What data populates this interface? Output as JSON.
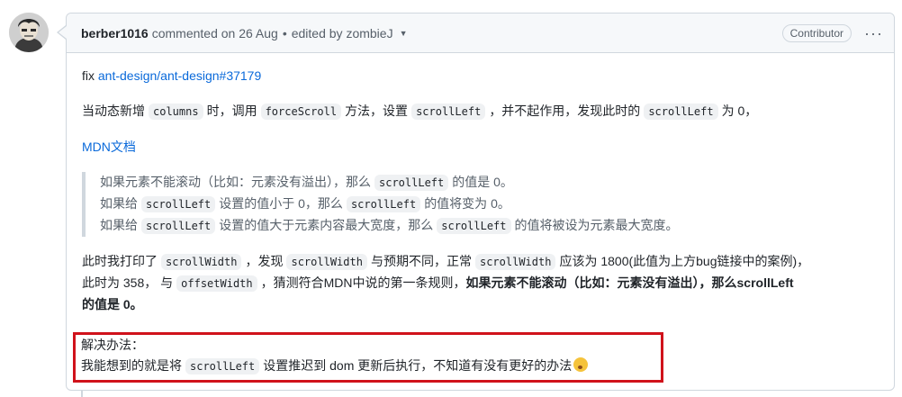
{
  "header": {
    "author": "berber1016",
    "action": "commented on 26 Aug",
    "separator": "•",
    "edited": "edited by zombieJ",
    "badge": "Contributor",
    "more": "···"
  },
  "body": {
    "fix_prefix": "fix",
    "fix_link": "ant-design/ant-design#37179",
    "p2": {
      "t1": "当动态新增",
      "c1": "columns",
      "t2": "时，调用",
      "c2": "forceScroll",
      "t3": "方法，设置",
      "c3": "scrollLeft",
      "t4": "，并不起作用，发现此时的",
      "c4": "scrollLeft",
      "t5": "为 0，"
    },
    "mdn_link": "MDN文档",
    "quote": {
      "l1a": "如果元素不能滚动（比如：元素没有溢出），那么",
      "l1c": "scrollLeft",
      "l1b": "的值是 0。",
      "l2a": "如果给",
      "l2c1": "scrollLeft",
      "l2b": "设置的值小于 0，那么",
      "l2c2": "scrollLeft",
      "l2d": "的值将变为 0。",
      "l3a": "如果给",
      "l3c1": "scrollLeft",
      "l3b": "设置的值大于元素内容最大宽度，那么",
      "l3c2": "scrollLeft",
      "l3d": "的值将被设为元素最大宽度。"
    },
    "p4": {
      "t1": "此时我打印了",
      "c1": "scrollWidth",
      "t2": "，发现",
      "c2": "scrollWidth",
      "t3": "与预期不同，正常",
      "c3": "scrollWidth",
      "t4": "应该为 1800(此值为上方bug链接中的案例)，",
      "t5": "此时为 358， 与",
      "c4": "offsetWidth",
      "t6": "，猜测符合MDN中说的第一条规则，",
      "b1": "如果元素不能滚动（比如：元素没有溢出），那么scrollLeft",
      "b2": "的值是 0。"
    },
    "solution": {
      "title": "解决办法：",
      "t1": "我能想到的就是将",
      "c1": "scrollLeft",
      "t2": "设置推迟到 dom 更新后执行，不知道有没有更好的办法"
    }
  },
  "colors": {
    "link": "#0969da",
    "highlight_border": "#d0121b"
  },
  "icons": [
    "avatar",
    "caret-down-icon",
    "kebab-icon",
    "worried-face-emoji"
  ]
}
